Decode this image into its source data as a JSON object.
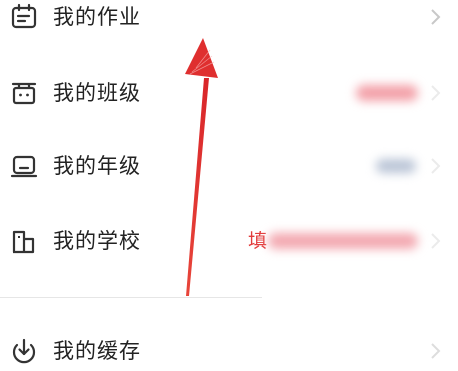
{
  "menu": {
    "items": [
      {
        "label": "我的作业",
        "icon": "homework-icon"
      },
      {
        "label": "我的班级",
        "icon": "class-icon"
      },
      {
        "label": "我的年级",
        "icon": "grade-icon"
      },
      {
        "label": "我的学校",
        "icon": "school-icon"
      },
      {
        "label": "我的缓存",
        "icon": "download-icon"
      }
    ],
    "school_value_prefix": "填"
  },
  "colors": {
    "accent_red": "#e23b3b",
    "icon": "#333333",
    "chevron": "#c8c8c8",
    "divider": "#e6e6e6"
  }
}
